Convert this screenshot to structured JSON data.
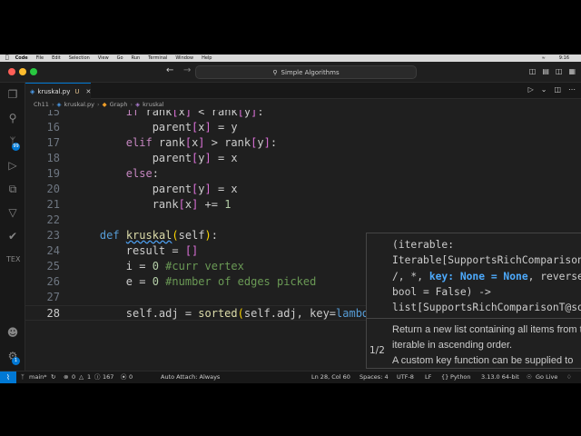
{
  "menubar": {
    "app": "Code",
    "items": [
      "File",
      "Edit",
      "Selection",
      "View",
      "Go",
      "Run",
      "Terminal",
      "Window",
      "Help"
    ],
    "clock": "9:16"
  },
  "titlebar": {
    "search_text": "Simple Algorithms"
  },
  "activitybar": {
    "badges": {
      "source_control": "99",
      "accounts": "1"
    },
    "tex_label": "TEX"
  },
  "tabs": [
    {
      "label": "kruskal.py",
      "modified_marker": "U"
    }
  ],
  "breadcrumbs": [
    "Ch11",
    "kruskal.py",
    "Graph",
    "kruskal"
  ],
  "editor": {
    "current_line": 28
  },
  "hint": {
    "signature_lines": [
      "(iterable:",
      "Iterable[SupportsRichComparisonT@",
      "/, *, key: None = None, reverse:",
      "bool = False) ->",
      "list[SupportsRichComparisonT@sort"
    ],
    "active_param": "key: None = None",
    "doc": "Return a new list containing all items from the iterable in ascending order.",
    "doc_more": "A custom key function can be supplied to",
    "counter": "1/2"
  },
  "statusbar": {
    "branch": "main*",
    "errors": "0",
    "warnings": "1",
    "info": "167",
    "ports": "0",
    "auto_attach": "Auto Attach: Always",
    "position": "Ln 28, Col 60",
    "spaces": "Spaces: 4",
    "encoding": "UTF-8",
    "eol": "LF",
    "language": "Python",
    "interpreter": "3.13.0 64-bit",
    "go_live": "Go Live"
  },
  "colors": {
    "accent": "#0078d4",
    "editor_bg": "#1f1f1f",
    "keyword": "#c586c0",
    "function": "#dcdcaa",
    "number": "#b5cea8",
    "comment": "#6a9955"
  }
}
